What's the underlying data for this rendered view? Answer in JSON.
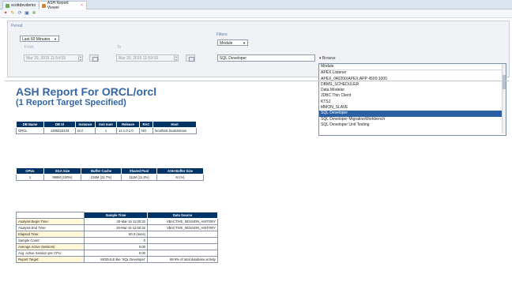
{
  "tabs": [
    {
      "label": "scottdevdemo"
    },
    {
      "label": "ASH Report Viewer"
    }
  ],
  "period": {
    "section_label": "Period",
    "range_value": "Last 60 Minutes",
    "from_label": "From",
    "to_label": "To",
    "from_value": "Mar 20, 2015 11:54:59",
    "to_value": "Mar 20, 2015 11:59:59"
  },
  "filters": {
    "section_label": "Filters",
    "type_value": "Module",
    "value": "SQL Developer",
    "browse_label": "▾ Browse"
  },
  "dropdown": {
    "items": [
      "Module",
      "APEX Listener",
      "APEX_040200/APEX:APP 4500:1000",
      "DBMS_SCHEDULER",
      "Data Modeler",
      "JDBC Thin Client",
      "KTSJ",
      "MMON_SLAVE",
      "SQL Developer",
      "SQL Developer MigrationWorkbench",
      "SQL Developer Unit Testing"
    ],
    "selected_index": 8
  },
  "report": {
    "title": "ASH Report For ORCL/orcl",
    "subtitle": "(1 Report Target Specified)"
  },
  "table1": {
    "headers": [
      "DB Name",
      "DB Id",
      "Instance",
      "Inst num",
      "Release",
      "RAC",
      "Host"
    ],
    "row": [
      "ORCL",
      "1365223133",
      "orcl",
      "1",
      "12.1.0.1.0",
      "NO",
      "localhost.localdomain"
    ]
  },
  "table2": {
    "headers": [
      "CPUs",
      "SGA Size",
      "Buffer Cache",
      "Shared Pool",
      "ASH Buffer Size"
    ],
    "row": [
      "1",
      "996M (100%)",
      "216M (21.7%)",
      "111M (11.2%)",
      "M (%)"
    ]
  },
  "table3": {
    "headers": [
      "",
      "Sample Time",
      "Data Source"
    ],
    "rows": [
      [
        "Analysis Begin Time:",
        "20-Mar-15 11:00:32",
        "V$ACTIVE_SESSION_HISTORY"
      ],
      [
        "Analysis End Time:",
        "20-Mar-15 12:00:32",
        "V$ACTIVE_SESSION_HISTORY"
      ],
      [
        "Elapsed Time:",
        "60.0 (mins)",
        ""
      ],
      [
        "Sample Count:",
        "0",
        ""
      ],
      [
        "Average Active Sessions:",
        "0.00",
        ""
      ],
      [
        "Avg. Active Session per CPU:",
        "0.00",
        ""
      ],
      [
        "Report Target:",
        "MODULE like 'SQL Developer'",
        "88.9% of total database activity"
      ]
    ]
  }
}
